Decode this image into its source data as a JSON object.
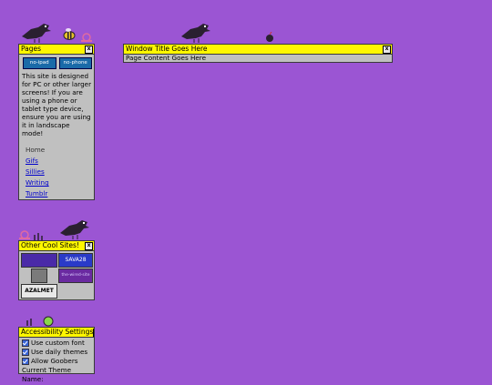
{
  "pages_window": {
    "title": "Pages",
    "close": "x",
    "badge_left": "no-ipad",
    "badge_right": "no-phone",
    "notice": "This site is designed for PC or other larger screens! If you are using a phone or tablet type device, ensure you are using it in landscape mode!",
    "nav": [
      "Home",
      "Gifs",
      "Sillies",
      "Writing",
      "Tumblr"
    ]
  },
  "main_window": {
    "title": "Window Title Goes Here",
    "close": "x",
    "content": "Page Content Goes Here"
  },
  "cool_sites_window": {
    "title": "Other Cool Sites!",
    "close": "x",
    "sites": [
      "",
      "SAVA28",
      "",
      "the-wired-site",
      "AZALMET"
    ]
  },
  "accessibility_window": {
    "title": "Accessibility Settings",
    "close": "x",
    "options": [
      "Use custom font",
      "Use daily themes",
      "Allow Goobers"
    ],
    "theme_label": "Current Theme Name:"
  },
  "colors": {
    "background": "#9b55d3",
    "titlebar": "#fff700",
    "window": "#c0c0c0",
    "link": "#0000cc"
  }
}
